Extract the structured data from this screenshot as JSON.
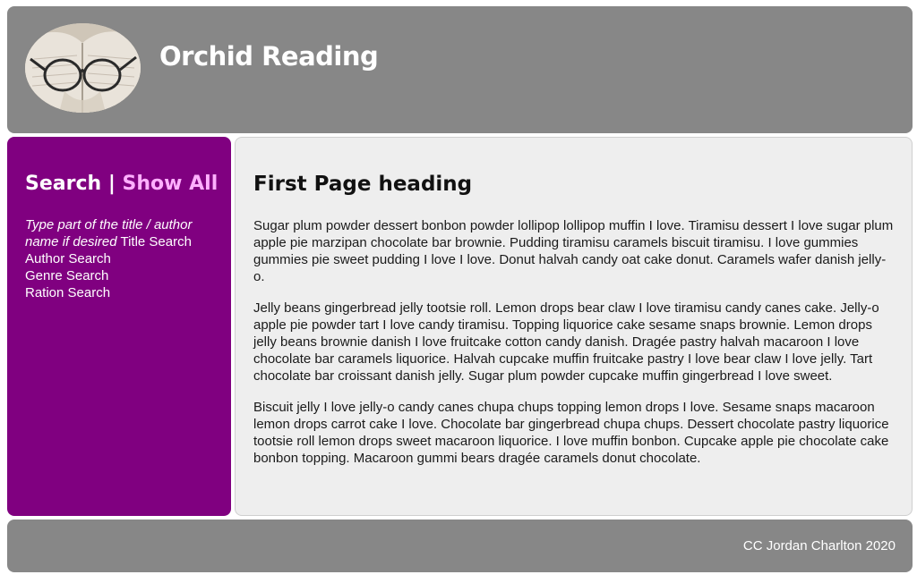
{
  "header": {
    "title": "Orchid Reading",
    "logo_icon": "glasses-on-book-icon"
  },
  "sidebar": {
    "search_label": "Search",
    "separator": " | ",
    "show_all_label": "Show All",
    "hint": "Type part of the title / author name if desired",
    "links": [
      {
        "label": "Title Search"
      },
      {
        "label": "Author Search"
      },
      {
        "label": "Genre Search"
      },
      {
        "label": "Ration Search"
      }
    ]
  },
  "main": {
    "heading": "First Page heading",
    "paragraphs": [
      "Sugar plum powder dessert bonbon powder lollipop lollipop muffin I love. Tiramisu dessert I love sugar plum apple pie marzipan chocolate bar brownie. Pudding tiramisu caramels biscuit tiramisu. I love gummies gummies pie sweet pudding I love I love. Donut halvah candy oat cake donut. Caramels wafer danish jelly-o.",
      "Jelly beans gingerbread jelly tootsie roll. Lemon drops bear claw I love tiramisu candy canes cake. Jelly-o apple pie powder tart I love candy tiramisu. Topping liquorice cake sesame snaps brownie. Lemon drops jelly beans brownie danish I love fruitcake cotton candy danish. Dragée pastry halvah macaroon I love chocolate bar caramels liquorice. Halvah cupcake muffin fruitcake pastry I love bear claw I love jelly. Tart chocolate bar croissant danish jelly. Sugar plum powder cupcake muffin gingerbread I love sweet.",
      "Biscuit jelly I love jelly-o candy canes chupa chups topping lemon drops I love. Sesame snaps macaroon lemon drops carrot cake I love. Chocolate bar gingerbread chupa chups. Dessert chocolate pastry liquorice tootsie roll lemon drops sweet macaroon liquorice. I love muffin bonbon. Cupcake apple pie chocolate cake bonbon topping. Macaroon gummi bears dragée caramels donut chocolate."
    ]
  },
  "footer": {
    "credit": "CC Jordan Charlton 2020"
  },
  "colors": {
    "header_bg": "#878787",
    "sidebar_bg": "#800080",
    "show_all": "#ffb0ff",
    "content_bg": "#eeeeee"
  }
}
